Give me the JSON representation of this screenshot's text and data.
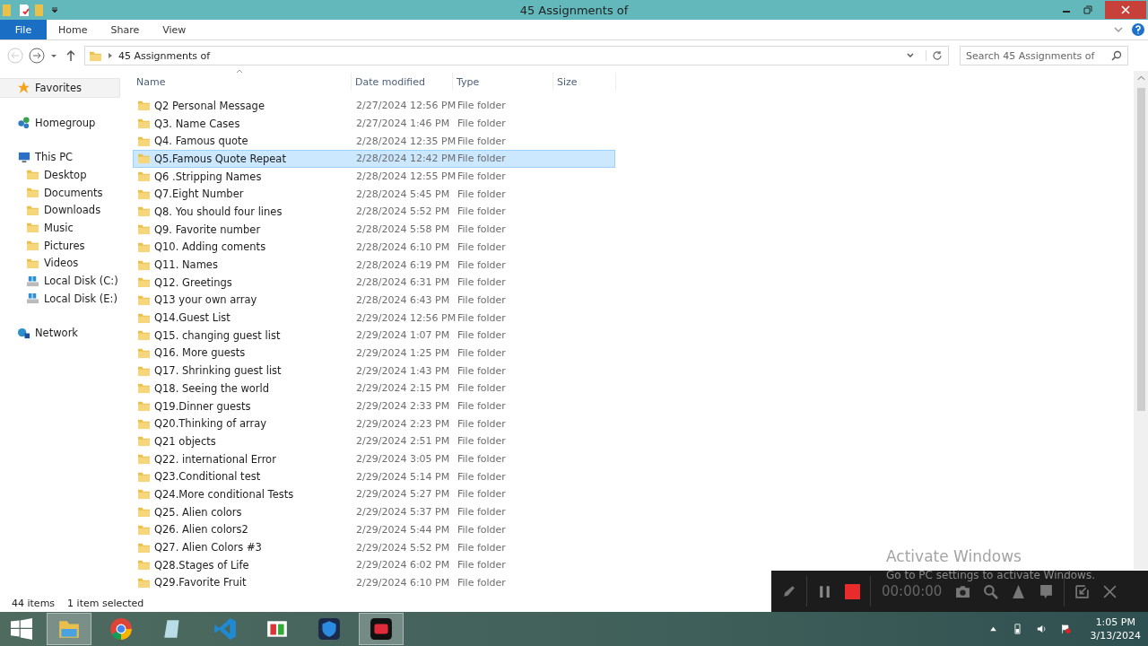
{
  "window": {
    "title": "45 Assignments of"
  },
  "ribbon_tabs": [
    {
      "label": "File",
      "kind": "file"
    },
    {
      "label": "Home",
      "kind": "tab"
    },
    {
      "label": "Share",
      "kind": "tab"
    },
    {
      "label": "View",
      "kind": "tab"
    }
  ],
  "address": {
    "path": "45 Assignments of"
  },
  "search": {
    "placeholder": "Search 45 Assignments of"
  },
  "sidebar": {
    "items": [
      {
        "label": "Favorites",
        "kind": "favorites",
        "selected": true
      },
      {
        "label": "Homegroup",
        "kind": "homegroup",
        "selected": false
      },
      {
        "label": "This PC",
        "kind": "pc",
        "selected": false,
        "children": [
          {
            "label": "Desktop",
            "kind": "folder",
            "selected": false
          },
          {
            "label": "Documents",
            "kind": "folder",
            "selected": false
          },
          {
            "label": "Downloads",
            "kind": "folder",
            "selected": false
          },
          {
            "label": "Music",
            "kind": "folder",
            "selected": false
          },
          {
            "label": "Pictures",
            "kind": "folder",
            "selected": false
          },
          {
            "label": "Videos",
            "kind": "folder",
            "selected": false
          },
          {
            "label": "Local Disk (C:)",
            "kind": "disk",
            "selected": false
          },
          {
            "label": "Local Disk (E:)",
            "kind": "disk",
            "selected": false
          }
        ]
      },
      {
        "label": "Network",
        "kind": "network",
        "selected": false
      }
    ]
  },
  "table": {
    "columns": [
      "Name",
      "Date modified",
      "Type",
      "Size"
    ],
    "rows": [
      {
        "name": "Q2 Personal Message",
        "date": "2/27/2024 12:56 PM",
        "type": "File folder",
        "selected": false
      },
      {
        "name": "Q3. Name Cases",
        "date": "2/27/2024 1:46 PM",
        "type": "File folder",
        "selected": false
      },
      {
        "name": "Q4. Famous quote",
        "date": "2/28/2024 12:35 PM",
        "type": "File folder",
        "selected": false
      },
      {
        "name": "Q5.Famous Quote Repeat",
        "date": "2/28/2024 12:42 PM",
        "type": "File folder",
        "selected": true
      },
      {
        "name": "Q6 .Stripping Names",
        "date": "2/28/2024 12:55 PM",
        "type": "File folder",
        "selected": false
      },
      {
        "name": "Q7.Eight Number",
        "date": "2/28/2024 5:45 PM",
        "type": "File folder",
        "selected": false
      },
      {
        "name": "Q8. You should four lines",
        "date": "2/28/2024 5:52 PM",
        "type": "File folder",
        "selected": false
      },
      {
        "name": "Q9. Favorite number",
        "date": "2/28/2024 5:58 PM",
        "type": "File folder",
        "selected": false
      },
      {
        "name": "Q10. Adding coments",
        "date": "2/28/2024 6:10 PM",
        "type": "File folder",
        "selected": false
      },
      {
        "name": "Q11. Names",
        "date": "2/28/2024 6:19 PM",
        "type": "File folder",
        "selected": false
      },
      {
        "name": "Q12. Greetings",
        "date": "2/28/2024 6:31 PM",
        "type": "File folder",
        "selected": false
      },
      {
        "name": "Q13 your own array",
        "date": "2/28/2024 6:43 PM",
        "type": "File folder",
        "selected": false
      },
      {
        "name": "Q14.Guest List",
        "date": "2/29/2024 12:56 PM",
        "type": "File folder",
        "selected": false
      },
      {
        "name": "Q15. changing guest list",
        "date": "2/29/2024 1:07 PM",
        "type": "File folder",
        "selected": false
      },
      {
        "name": "Q16. More guests",
        "date": "2/29/2024 1:25 PM",
        "type": "File folder",
        "selected": false
      },
      {
        "name": "Q17. Shrinking guest list",
        "date": "2/29/2024 1:43 PM",
        "type": "File folder",
        "selected": false
      },
      {
        "name": "Q18. Seeing the world",
        "date": "2/29/2024 2:15 PM",
        "type": "File folder",
        "selected": false
      },
      {
        "name": "Q19.Dinner guests",
        "date": "2/29/2024 2:33 PM",
        "type": "File folder",
        "selected": false
      },
      {
        "name": "Q20.Thinking of array",
        "date": "2/29/2024 2:23 PM",
        "type": "File folder",
        "selected": false
      },
      {
        "name": "Q21 objects",
        "date": "2/29/2024 2:51 PM",
        "type": "File folder",
        "selected": false
      },
      {
        "name": "Q22. international Error",
        "date": "2/29/2024 3:05 PM",
        "type": "File folder",
        "selected": false
      },
      {
        "name": "Q23.Conditional test",
        "date": "2/29/2024 5:14 PM",
        "type": "File folder",
        "selected": false
      },
      {
        "name": "Q24.More conditional Tests",
        "date": "2/29/2024 5:27 PM",
        "type": "File folder",
        "selected": false
      },
      {
        "name": "Q25. Alien colors",
        "date": "2/29/2024 5:37 PM",
        "type": "File folder",
        "selected": false
      },
      {
        "name": "Q26. Alien colors2",
        "date": "2/29/2024 5:44 PM",
        "type": "File folder",
        "selected": false
      },
      {
        "name": "Q27. Alien Colors #3",
        "date": "2/29/2024 5:52 PM",
        "type": "File folder",
        "selected": false
      },
      {
        "name": "Q28.Stages of Life",
        "date": "2/29/2024 6:02 PM",
        "type": "File folder",
        "selected": false
      },
      {
        "name": "Q29.Favorite Fruit",
        "date": "2/29/2024 6:10 PM",
        "type": "File folder",
        "selected": false
      }
    ]
  },
  "status_bar": {
    "count": "44 items",
    "selection": "1 item selected"
  },
  "activation_notice": {
    "title": "Activate Windows",
    "text": "Go to PC settings to activate Windows."
  },
  "recorder": {
    "timer": "00:00:00"
  },
  "taskbar": {
    "apps": [
      {
        "kind": "explorer",
        "active": true
      },
      {
        "kind": "chrome",
        "active": false
      },
      {
        "kind": "notepad",
        "active": false
      },
      {
        "kind": "vscode",
        "active": false
      },
      {
        "kind": "meter",
        "active": false
      },
      {
        "kind": "shield",
        "active": false
      },
      {
        "kind": "recorder",
        "active": true
      }
    ],
    "time": "1:05 PM",
    "date": "3/13/2024"
  }
}
